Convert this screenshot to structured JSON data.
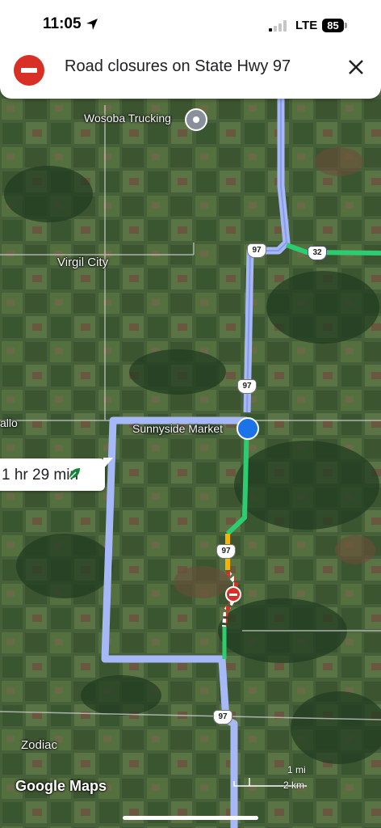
{
  "status_bar": {
    "time": "11:05",
    "network": "LTE",
    "battery": "85",
    "location_icon": "location-arrow-icon",
    "signal_icon": "cellular-signal-icon"
  },
  "banner": {
    "text": "Road closures on State Hwy 97",
    "icon": "road-closed-icon",
    "close_icon": "close-icon"
  },
  "places": {
    "wosoba": "Wosoba Trucking",
    "virgil": "Virgil City",
    "sunnyside": "Sunnyside Market",
    "allo": "allo",
    "zodiac": "Zodiac"
  },
  "route_shields": {
    "s1": "97",
    "s2": "32",
    "s3": "97",
    "s4": "97",
    "s5": "97"
  },
  "eta": {
    "text": "1 hr 29 min",
    "icon": "eco-leaf-icon"
  },
  "attribution": "Google Maps",
  "scale": {
    "miles": "1 mi",
    "km": "2 km"
  },
  "colors": {
    "route": "#a7b8f7",
    "traffic_clear": "#2ecc71",
    "traffic_slow": "#f4b400",
    "closure": "#d93025",
    "accent_blue": "#1a73e8"
  }
}
